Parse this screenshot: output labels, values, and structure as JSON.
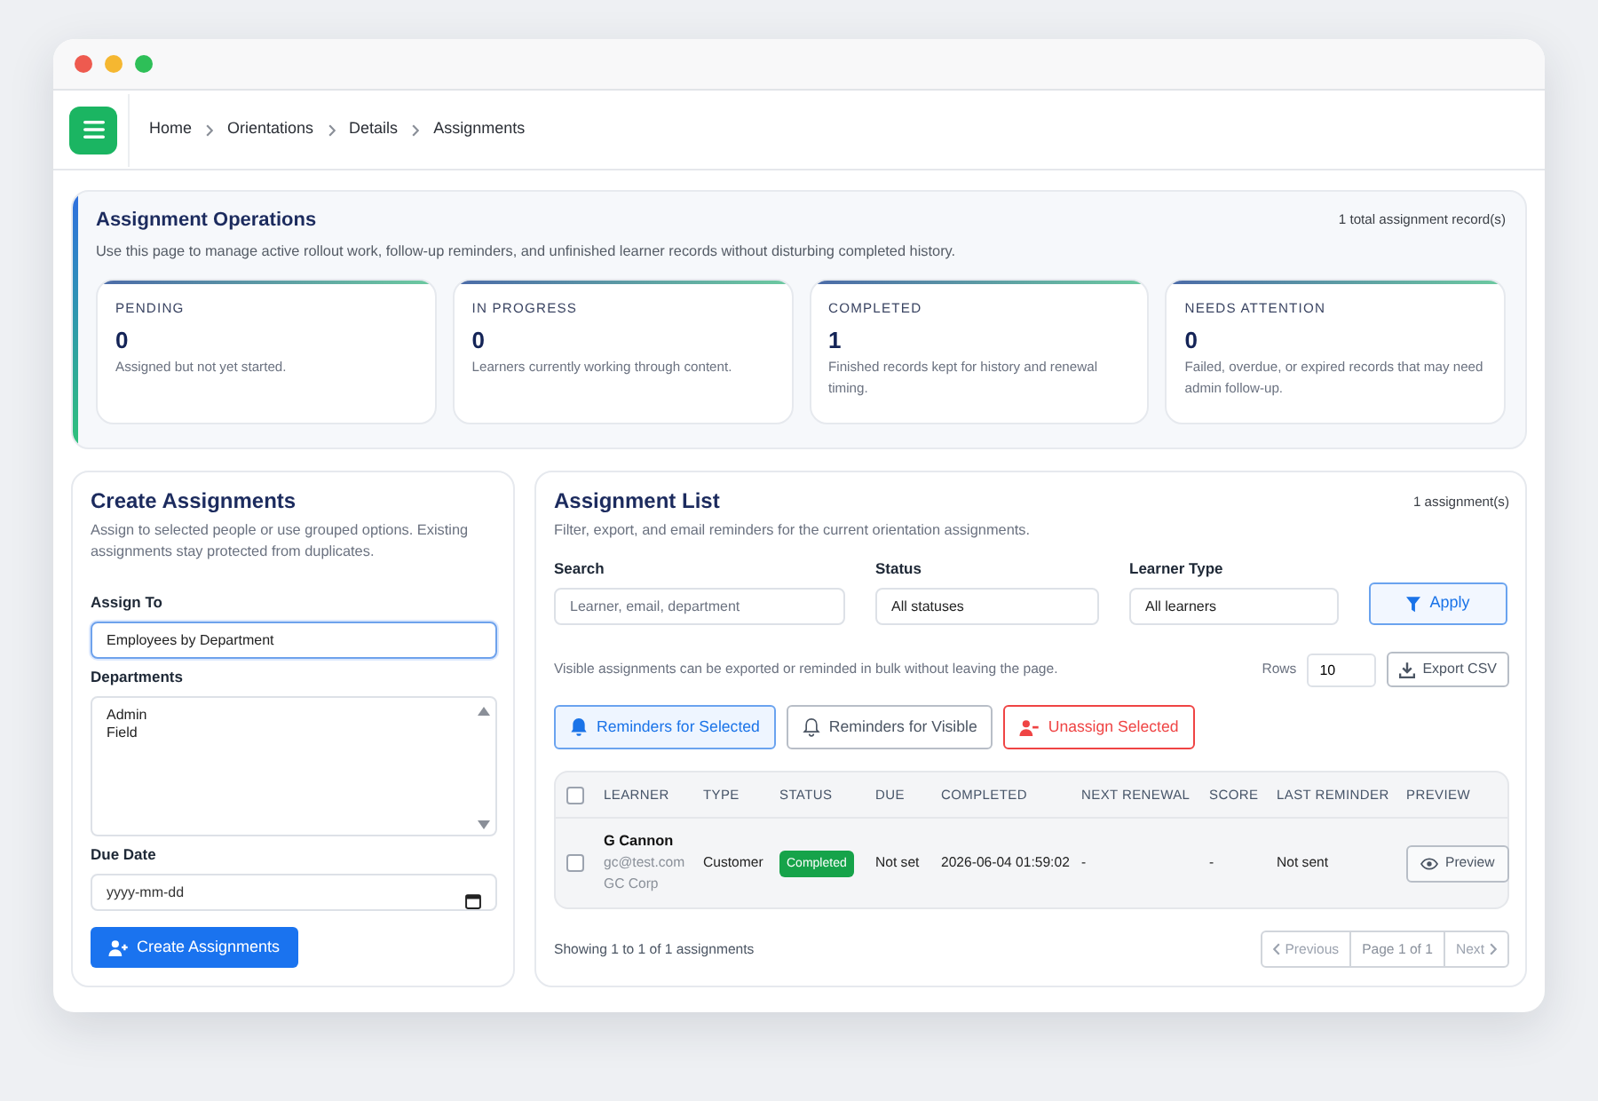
{
  "window": {
    "traffic_lights": [
      {
        "color": "#ee5a4f"
      },
      {
        "color": "#f5b731"
      },
      {
        "color": "#2ebf58"
      }
    ]
  },
  "header": {
    "breadcrumb": [
      "Home",
      "Orientations",
      "Details",
      "Assignments"
    ]
  },
  "operations": {
    "title": "Assignment Operations",
    "description": "Use this page to manage active rollout work, follow-up reminders, and unfinished learner records without disturbing completed history.",
    "record_count": "1 total assignment record(s)",
    "stats": [
      {
        "label": "PENDING",
        "value": "0",
        "description": "Assigned but not yet started."
      },
      {
        "label": "IN PROGRESS",
        "value": "0",
        "description": "Learners currently working through content."
      },
      {
        "label": "COMPLETED",
        "value": "1",
        "description": "Finished records kept for history and renewal timing."
      },
      {
        "label": "NEEDS ATTENTION",
        "value": "0",
        "description": "Failed, overdue, or expired records that may need admin follow-up."
      }
    ]
  },
  "create_form": {
    "title": "Create Assignments",
    "description": "Assign to selected people or use grouped options. Existing assignments stay protected from duplicates.",
    "fields": [
      {
        "kind": "select",
        "label": "Assign To",
        "value": "Employees by Department",
        "focused": true
      },
      {
        "kind": "listbox",
        "label": "Departments",
        "options": [
          "Admin",
          "Field"
        ],
        "focused": false
      },
      {
        "kind": "date",
        "label": "Due Date",
        "placeholder": "yyyy-mm-dd",
        "focused": false
      }
    ],
    "submit": "Create Assignments"
  },
  "assignment_list": {
    "title": "Assignment List",
    "count": "1 assignment(s)",
    "description": "Filter, export, and email reminders for the current orientation assignments.",
    "filters": [
      {
        "kind": "text",
        "label": "Search",
        "placeholder": "Learner, email, department"
      },
      {
        "kind": "select",
        "label": "Status",
        "value": "All statuses"
      },
      {
        "kind": "select",
        "label": "Learner Type",
        "value": "All learners"
      }
    ],
    "apply": "Apply",
    "note": "Visible assignments can be exported or reminded in bulk without leaving the page.",
    "rows_label": "Rows",
    "rows_value": "10",
    "export": "Export CSV",
    "bulk_actions": [
      {
        "kind": "primary",
        "label": "Reminders for Selected"
      },
      {
        "kind": "secondary",
        "label": "Reminders for Visible"
      },
      {
        "kind": "danger",
        "label": "Unassign Selected"
      }
    ],
    "table": {
      "select_all": {
        "checked": false
      },
      "columns": [
        "LEARNER",
        "TYPE",
        "STATUS",
        "DUE",
        "COMPLETED",
        "NEXT RENEWAL",
        "SCORE",
        "LAST REMINDER",
        "PREVIEW"
      ],
      "rows": [
        {
          "selected": false,
          "learner": {
            "name": "G Cannon",
            "email": "gc@test.com",
            "company": "GC Corp"
          },
          "type": "Customer",
          "status": {
            "label": "Completed",
            "color": "#16a34a"
          },
          "due": "Not set",
          "completed": "2026-06-04 01:59:02",
          "next_renewal": "-",
          "score": "-",
          "last_reminder": "Not sent",
          "preview": "Preview"
        }
      ]
    },
    "summary": "Showing 1 to 1 of 1 assignments",
    "pagination": {
      "previous": {
        "label": "Previous",
        "disabled": true
      },
      "page": "Page 1 of 1",
      "next": {
        "label": "Next",
        "disabled": true
      }
    }
  }
}
